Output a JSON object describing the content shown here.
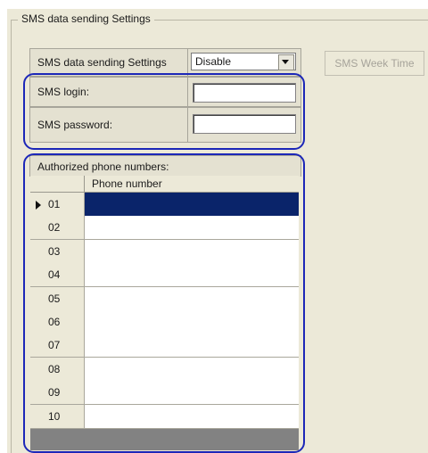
{
  "group": {
    "title": "SMS data sending Settings"
  },
  "settings": {
    "mode_label": "SMS data sending Settings",
    "mode_value": "Disable",
    "login_label": "SMS login:",
    "login_value": "",
    "password_label": "SMS password:",
    "password_value": ""
  },
  "week_button": {
    "label": "SMS Week Time"
  },
  "phones": {
    "title": "Authorized phone numbers:",
    "column_header": "Phone number",
    "rows": [
      {
        "num": "01",
        "phone": "",
        "selected": true
      },
      {
        "num": "02",
        "phone": ""
      },
      {
        "num": "03",
        "phone": ""
      },
      {
        "num": "04",
        "phone": ""
      },
      {
        "num": "05",
        "phone": ""
      },
      {
        "num": "06",
        "phone": ""
      },
      {
        "num": "07",
        "phone": ""
      },
      {
        "num": "08",
        "phone": ""
      },
      {
        "num": "09",
        "phone": ""
      },
      {
        "num": "10",
        "phone": ""
      }
    ]
  },
  "colors": {
    "highlight_outline": "#1c27b8",
    "selected_row": "#0a246a",
    "panel_bg": "#ece9d8"
  }
}
